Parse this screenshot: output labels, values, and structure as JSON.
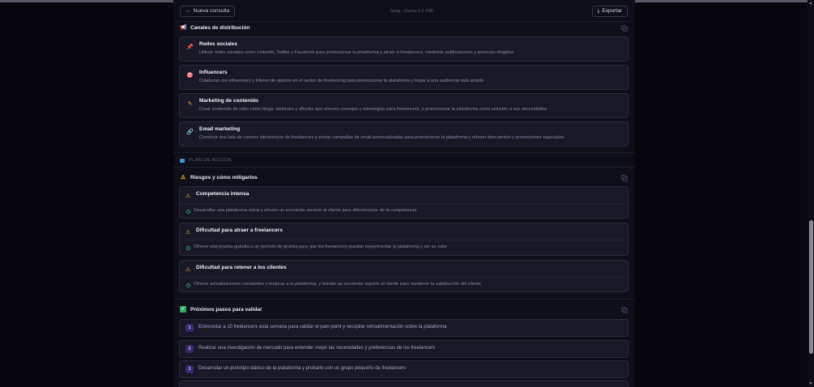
{
  "toolbar": {
    "back_label": "Nueva consulta",
    "back_icon": "arrow-left-icon",
    "model_label": "Groq · Llama 3.3 70B",
    "export_label": "Exportar",
    "export_icon": "download-icon"
  },
  "channels": {
    "title": "Canales de distribución",
    "icon": "megaphone-icon",
    "items": [
      {
        "title": "Redes sociales",
        "icon": "pin-icon",
        "desc": "Utilizar redes sociales como LinkedIn, Twitter y Facebook para promocionar la plataforma y atraer a freelancers, mediante publicaciones y anuncios dirigidos"
      },
      {
        "title": "Influencers",
        "icon": "target-icon",
        "desc": "Colaborar con influencers y líderes de opinión en el sector de freelancing para promocionar la plataforma y llegar a una audiencia más amplia"
      },
      {
        "title": "Marketing de contenido",
        "icon": "pencil-icon",
        "desc": "Crear contenido de valor como blogs, webinars y eBooks que ofrecen consejos y estrategias para freelancers, y promocionar la plataforma como solución a sus necesidades"
      },
      {
        "title": "Email marketing",
        "icon": "link-icon",
        "desc": "Construir una lista de correos electrónicos de freelancers y enviar campañas de email personalizadas para promocionar la plataforma y ofrecer descuentos y promociones especiales"
      }
    ]
  },
  "plan": {
    "label": "PLAN DE ACCIÓN"
  },
  "risks": {
    "title": "Riesgos y cómo mitigarlos",
    "icon": "warning-icon",
    "items": [
      {
        "title": "Competencia intensa",
        "mitigation": "Desarrollar una plataforma única y ofrecer un excelente servicio al cliente para diferenciarse de la competencia"
      },
      {
        "title": "Dificultad para atraer a freelancers",
        "mitigation": "Ofrecer una prueba gratuita o un período de prueba para que los freelancers puedan experimentar la plataforma y ver su valor"
      },
      {
        "title": "Dificultad para retener a los clientes",
        "mitigation": "Ofrecer actualizaciones constantes y mejoras a la plataforma, y brindar un excelente soporte al cliente para mantener la satisfacción del cliente"
      }
    ]
  },
  "steps": {
    "title": "Próximos pasos para validar",
    "icon": "checkbox-icon",
    "items": [
      {
        "num": "1",
        "text": "Entrevistar a 10 freelancers esta semana para validar el pain point y recopilar retroalimentación sobre la plataforma"
      },
      {
        "num": "2",
        "text": "Realizar una investigación de mercado para entender mejor las necesidades y preferencias de los freelancers"
      },
      {
        "num": "3",
        "text": "Desarrollar un prototipo básico de la plataforma y probarlo con un grupo pequeño de freelancers"
      }
    ]
  },
  "colors": {
    "background": "#07070d",
    "panel": "#0f0f1a",
    "card": "#181827",
    "warning": "#f0b429",
    "success": "#2fa66a",
    "step_badge": "#3a2a6e"
  }
}
